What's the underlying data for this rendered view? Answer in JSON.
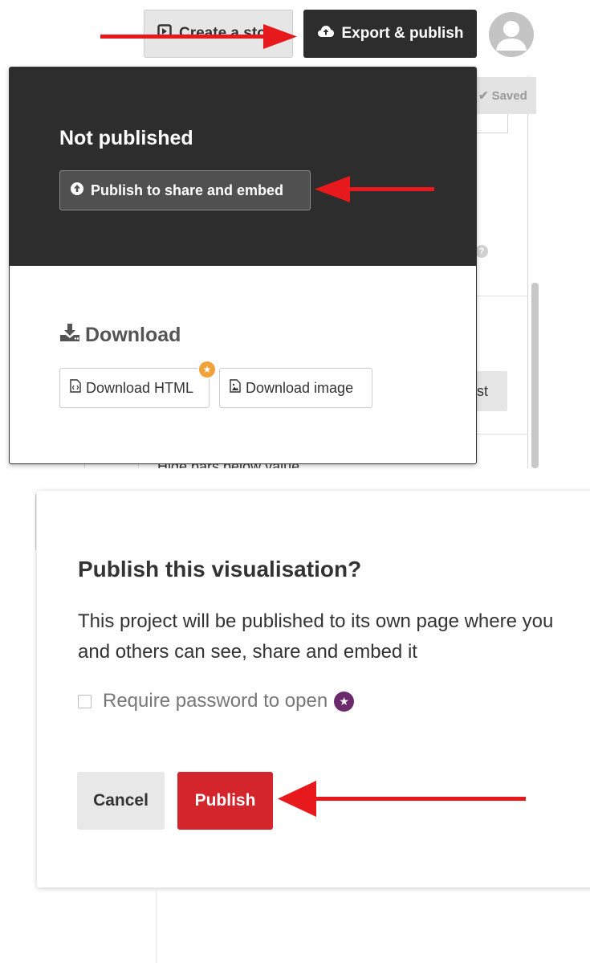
{
  "header": {
    "create_story_label": "Create a sto",
    "export_publish_label": "Export & publish",
    "avatar_icon": "user-avatar-icon"
  },
  "background_panel": {
    "saved_label": "Saved",
    "partial_button_label": "st",
    "hide_bars_label": "Hide bars below value"
  },
  "export_dropdown": {
    "status_title": "Not published",
    "publish_button_label": "Publish to share and embed",
    "download_title": "Download",
    "download_html_label": "Download HTML",
    "download_image_label": "Download image"
  },
  "publish_modal": {
    "title": "Publish this visualisation?",
    "description": "This project will be published to its own page where you and others can see, share and embed it",
    "password_label": "Require password to open",
    "password_checked": false,
    "cancel_label": "Cancel",
    "publish_label": "Publish"
  },
  "colors": {
    "dark_header": "#2d2d2d",
    "publish_red": "#d4242c",
    "annotation_red": "#e8191c",
    "premium_orange": "#f0a13a",
    "premium_purple": "#6b2a6b"
  }
}
